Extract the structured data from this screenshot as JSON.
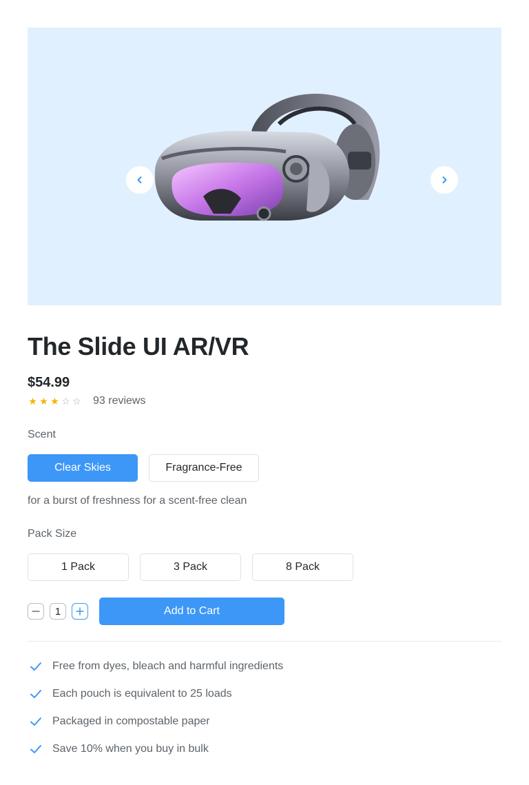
{
  "product": {
    "title": "The Slide UI AR/VR",
    "price": "$54.99",
    "rating_stars": 3,
    "rating_max": 5,
    "reviews_label": "93 reviews",
    "image_icon": "vr-headset-image"
  },
  "gallery": {
    "prev_icon": "chevron-left-icon",
    "next_icon": "chevron-right-icon"
  },
  "scent": {
    "label": "Scent",
    "options": [
      {
        "label": "Clear Skies",
        "selected": true
      },
      {
        "label": "Fragrance-Free",
        "selected": false
      }
    ],
    "description": "for a burst of freshness for a scent-free clean"
  },
  "pack_size": {
    "label": "Pack Size",
    "options": [
      {
        "label": "1 Pack"
      },
      {
        "label": "3 Pack"
      },
      {
        "label": "8 Pack"
      }
    ]
  },
  "quantity": {
    "value": "1"
  },
  "cart": {
    "button_label": "Add to Cart"
  },
  "features": [
    "Free from dyes, bleach and harmful ingredients",
    "Each pouch is equivalent to 25 loads",
    "Packaged in compostable paper",
    "Save 10% when you buy in bulk"
  ],
  "colors": {
    "accent": "#3d97f6",
    "hero_bg": "#e1f0fe",
    "star": "#f5b301"
  }
}
